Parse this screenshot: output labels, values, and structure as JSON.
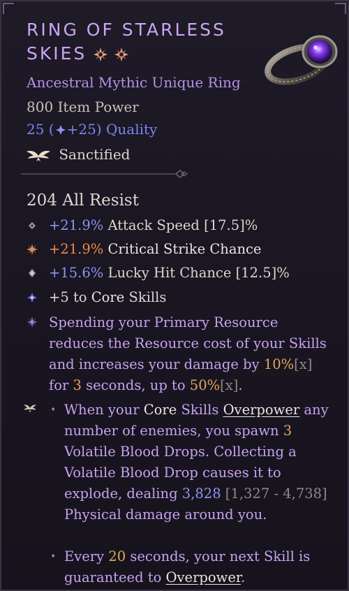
{
  "item": {
    "name_line1": "Ring of Starless",
    "name_line2": "Skies",
    "rarity": "Ancestral Mythic Unique Ring",
    "item_power": "800 Item Power",
    "quality": {
      "base": "25",
      "bonus": "+25",
      "label": "Quality"
    },
    "sanctified": "Sanctified"
  },
  "resist": "204 All Resist",
  "affixes": [
    {
      "value": "+21.9%",
      "label": "Attack Speed",
      "range": "[17.5]%"
    },
    {
      "value": "+21.9%",
      "label": "Critical Strike Chance"
    },
    {
      "value": "+15.6%",
      "label": "Lucky Hit Chance",
      "range": "[12.5]%"
    },
    {
      "value": "+5 to",
      "highlight": "Core",
      "label": "Skills"
    }
  ],
  "unique_power": {
    "part1": "Spending your Primary Resource reduces the Resource cost of your Skills and increases your damage by ",
    "val1": "10%",
    "x1": "[x]",
    "part2": " for ",
    "val2": "3",
    "part3": " seconds, up to ",
    "val3": "50%",
    "x2": "[x]",
    "part4": "."
  },
  "sanctified_bullets": [
    {
      "t1": "When your ",
      "core": "Core",
      "t2": " Skills ",
      "overpower": "Overpower",
      "t3": " any number of enemies, you spawn ",
      "count": "3",
      "t4": " Volatile Blood Drops. Collecting a Volatile Blood Drop causes it to explode, dealing ",
      "dmg": "3,828",
      "range": " [1,327 - 4,738]",
      "t5": " Physical damage around you."
    },
    {
      "t1": "Every ",
      "secs": "20",
      "t2": " seconds, your next Skill is guaranteed to ",
      "overpower": "Overpower",
      "t3": "."
    }
  ],
  "colors": {
    "title": "#c9a6f3",
    "rarity": "#b392e8",
    "quality": "#7c86f0",
    "value_blue": "#8b95f5",
    "value_orange": "#ee8a45",
    "value_gold": "#e0a95a",
    "unique_text": "#c5a3f0"
  },
  "icons": [
    "starburst-icon",
    "ring-image",
    "quality-gem-icon",
    "sanctified-wings-icon",
    "diamond-bullet-icon",
    "crit-bullet-icon",
    "lucky-bullet-icon",
    "core-skill-bullet-icon",
    "unique-power-icon"
  ]
}
